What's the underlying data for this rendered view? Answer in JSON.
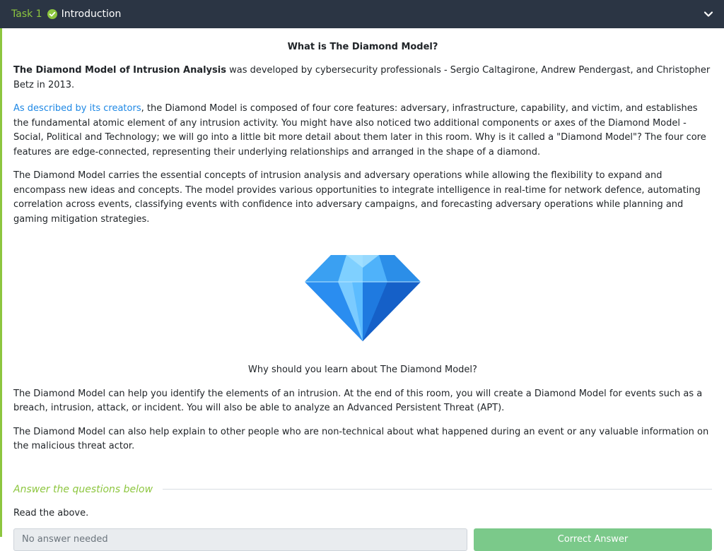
{
  "header": {
    "task_label": "Task 1",
    "title": "Introduction",
    "status_icon": "check-circle-icon",
    "toggle_icon": "chevron-down-icon"
  },
  "content": {
    "heading": "What is The Diamond Model?",
    "p1": {
      "bold": "The Diamond Model of Intrusion Analysis",
      "rest": " was developed by cybersecurity professionals - Sergio Caltagirone, Andrew Pendergast, and Christopher Betz in 2013."
    },
    "p2": {
      "link": "As described by its creators",
      "rest": ", the Diamond Model is composed of four core features: adversary, infrastructure, capability, and victim, and establishes the fundamental atomic element of any intrusion activity. You might have also noticed two additional components or axes of the Diamond Model - Social, Political and Technology; we will go into a little bit more detail about them later in this room. Why is it called a \"Diamond Model\"? The four core features are edge-connected, representing their underlying relationships and arranged in the shape of a diamond."
    },
    "p3": "The Diamond Model carries the essential concepts of intrusion analysis and adversary operations while allowing the flexibility to expand and encompass new ideas and concepts. The model provides various opportunities to integrate intelligence in real-time for network defence, automating correlation across events, classifying events with confidence into adversary campaigns, and forecasting adversary operations while planning and gaming mitigation strategies.",
    "image_icon": "diamond-gem-icon",
    "subheading": "Why should you learn about The Diamond Model?",
    "p4": "The Diamond Model can help you identify the elements of an intrusion. At the end of this room, you will create a Diamond Model for events such as a breach, intrusion, attack, or incident. You will also be able to analyze an Advanced Persistent Threat (APT).",
    "p5": "The Diamond Model can also help explain to other people who are non-technical about what happened during an event or any valuable information on the malicious threat actor."
  },
  "answers": {
    "section_title": "Answer the questions below",
    "question": "Read the above.",
    "input_placeholder": "No answer needed",
    "button_label": "Correct Answer"
  },
  "colors": {
    "header_bg": "#2b3544",
    "accent_green": "#8dc63f",
    "link_blue": "#1e88e5",
    "button_green": "#7bc98a"
  }
}
